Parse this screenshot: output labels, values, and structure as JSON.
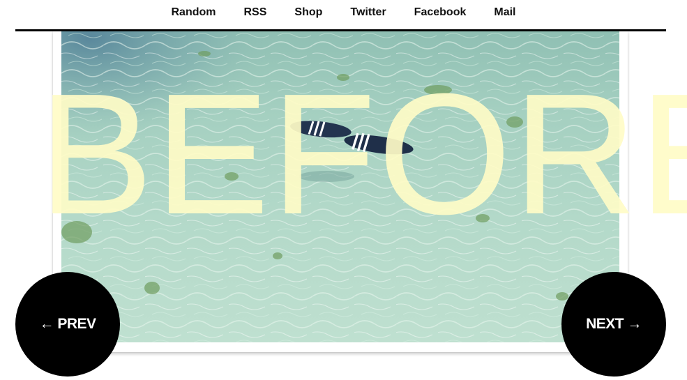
{
  "nav": {
    "items": [
      {
        "label": "Random"
      },
      {
        "label": "RSS"
      },
      {
        "label": "Shop"
      },
      {
        "label": "Twitter"
      },
      {
        "label": "Facebook"
      },
      {
        "label": "Mail"
      }
    ]
  },
  "comic": {
    "caption": "BEFORE",
    "caption_color": "#fffcc7",
    "water_color": "#a9d2c3"
  },
  "pager": {
    "prev_label": "← PREV",
    "next_label": "NEXT →"
  }
}
